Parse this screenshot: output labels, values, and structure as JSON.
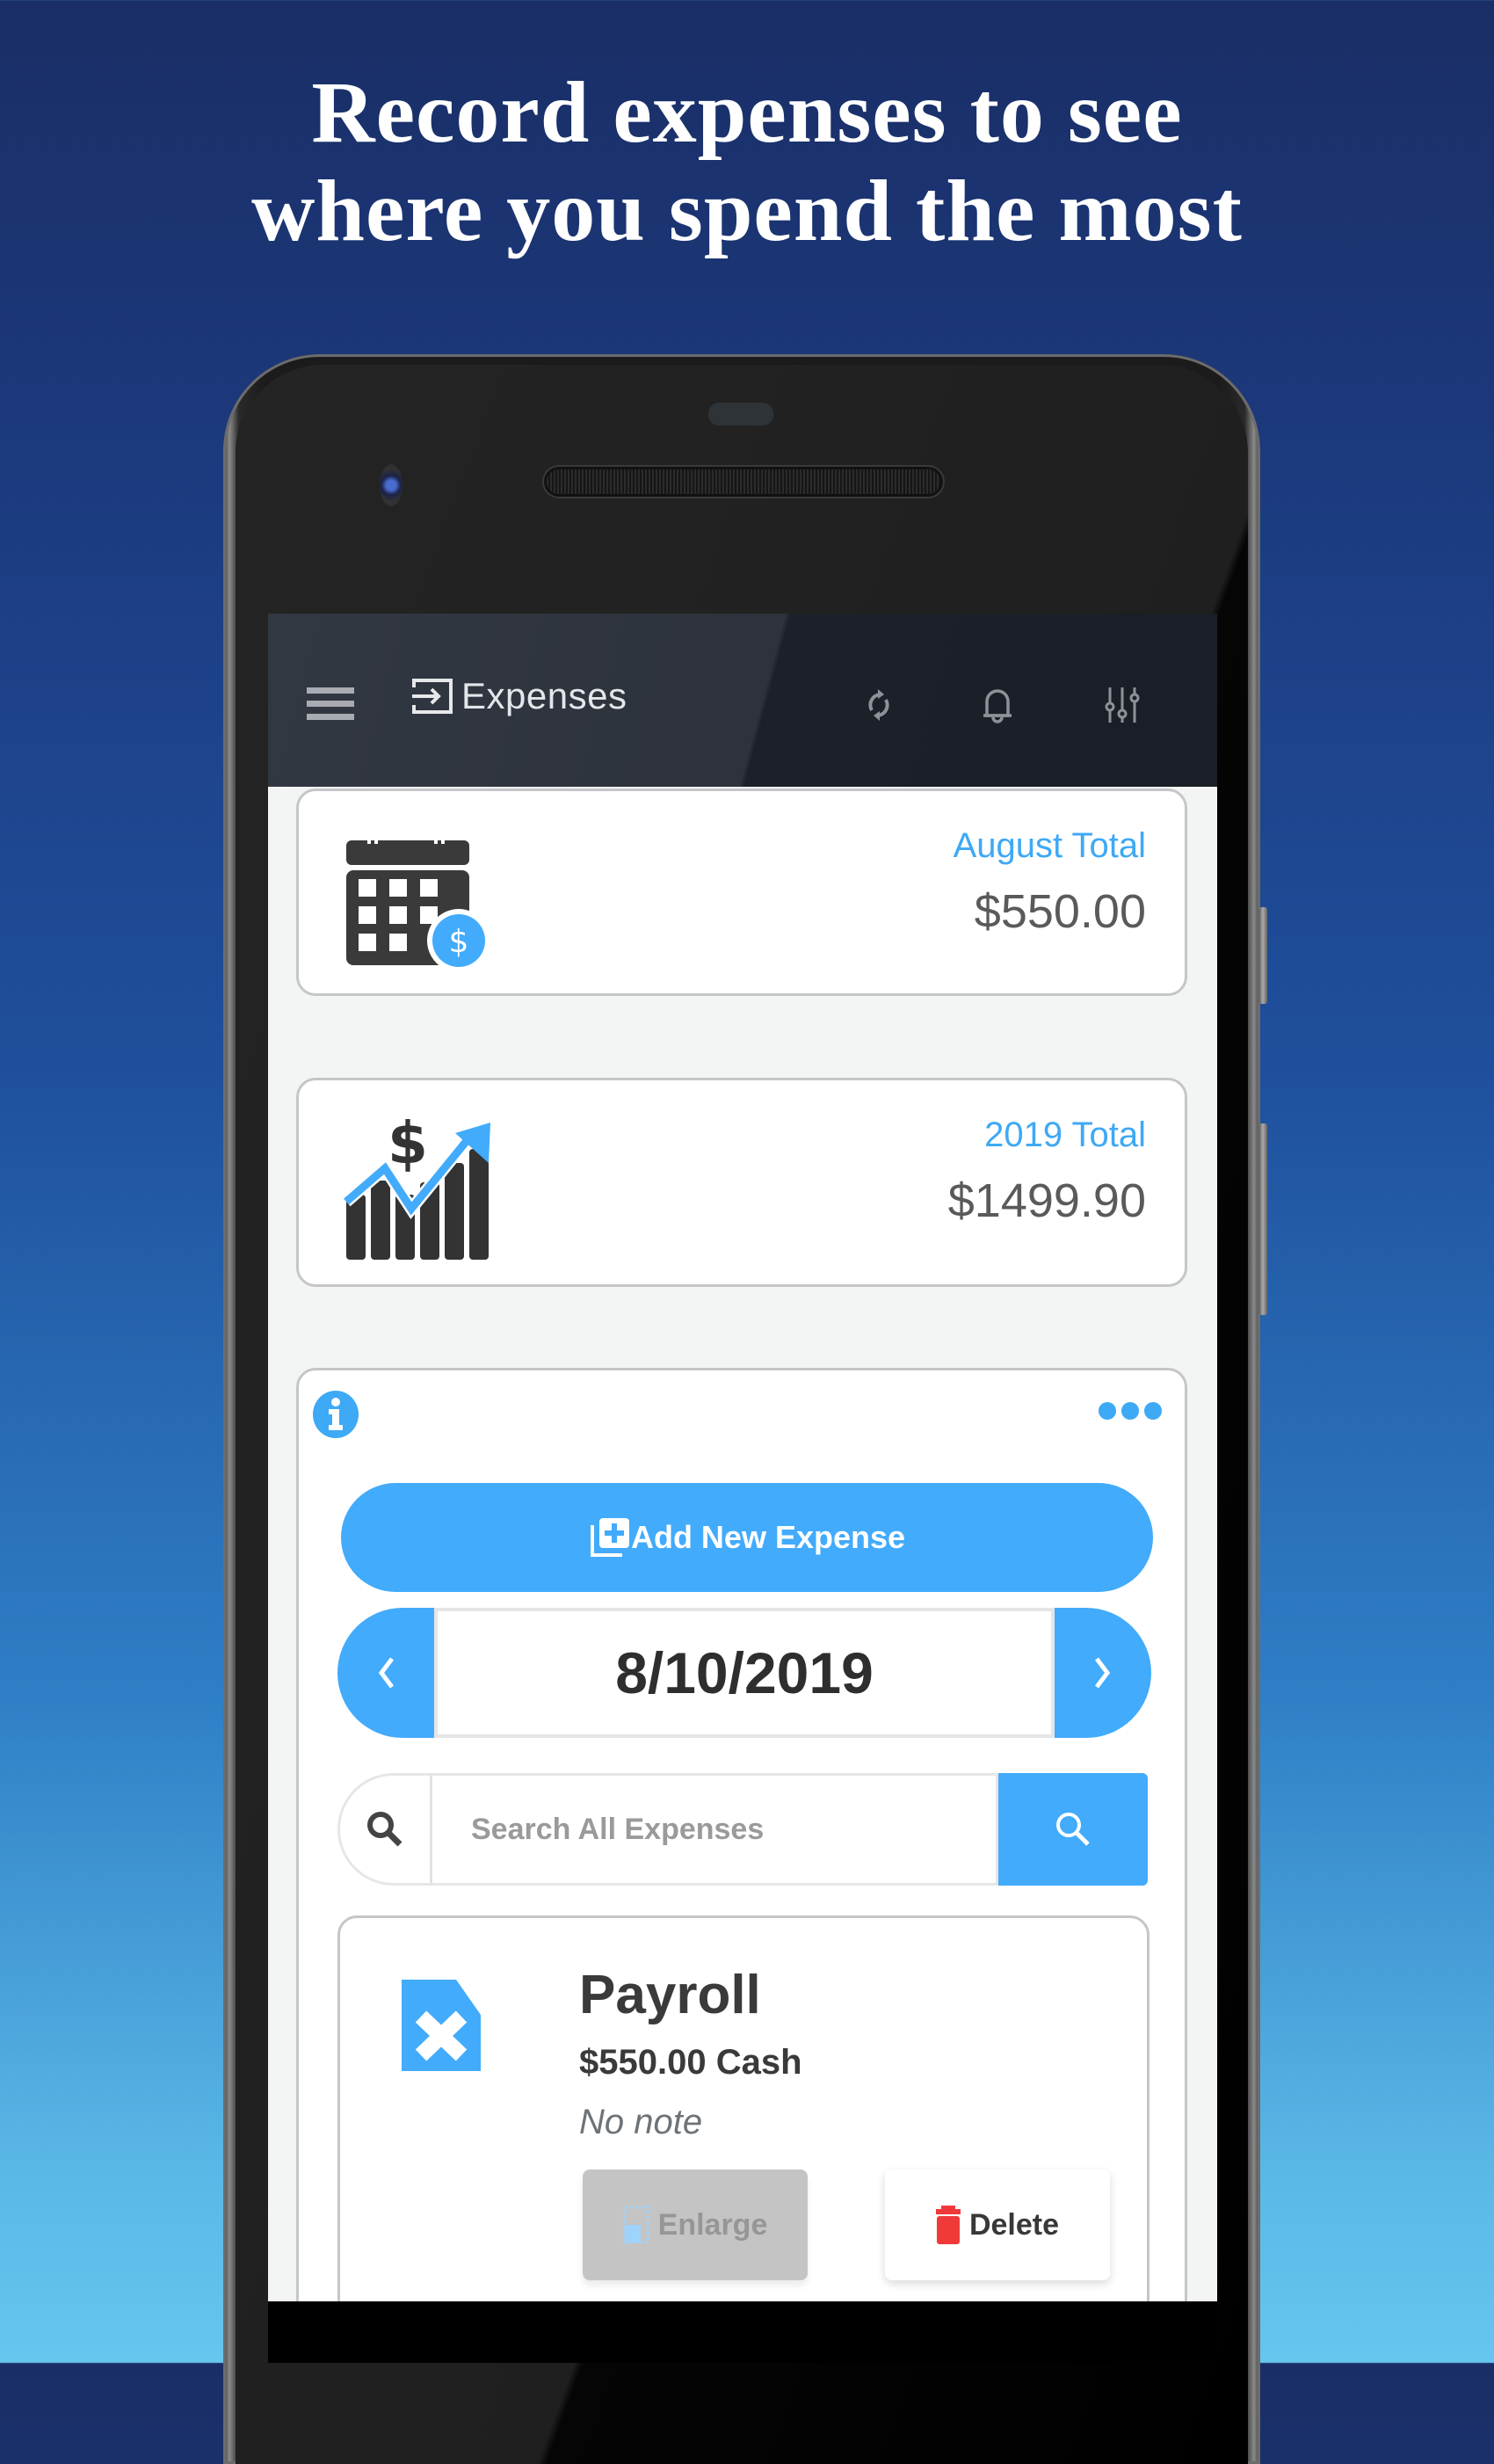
{
  "headline": {
    "line1": "Record expenses to see",
    "line2": "where you spend the most"
  },
  "app": {
    "title": "Expenses",
    "icons": {
      "menu": "hamburger-menu-icon",
      "title": "sign-in-arrow-icon",
      "sync": "sync-icon",
      "notifications": "bell-icon",
      "settings": "sliders-icon"
    }
  },
  "stats": [
    {
      "label": "August Total",
      "value": "$550.00",
      "icon": "calendar-dollar-icon"
    },
    {
      "label": "2019 Total",
      "value": "$1499.90",
      "icon": "chart-growth-dollar-icon"
    }
  ],
  "panel": {
    "info_icon": "info-icon",
    "more_icon": "more-dots-icon",
    "add_button_label": "Add New Expense",
    "date": "8/10/2019",
    "search": {
      "placeholder": "Search All Expenses",
      "value": ""
    }
  },
  "expense": {
    "title": "Payroll",
    "amount": "$550.00 Cash",
    "note": "No note",
    "icon": "file-x-icon",
    "enlarge_label": "Enlarge",
    "delete_label": "Delete"
  },
  "colors": {
    "accent": "#42abfb",
    "label_blue": "#3ea9f5",
    "delete_red": "#f03a3a",
    "appbar": "#2d323b"
  }
}
